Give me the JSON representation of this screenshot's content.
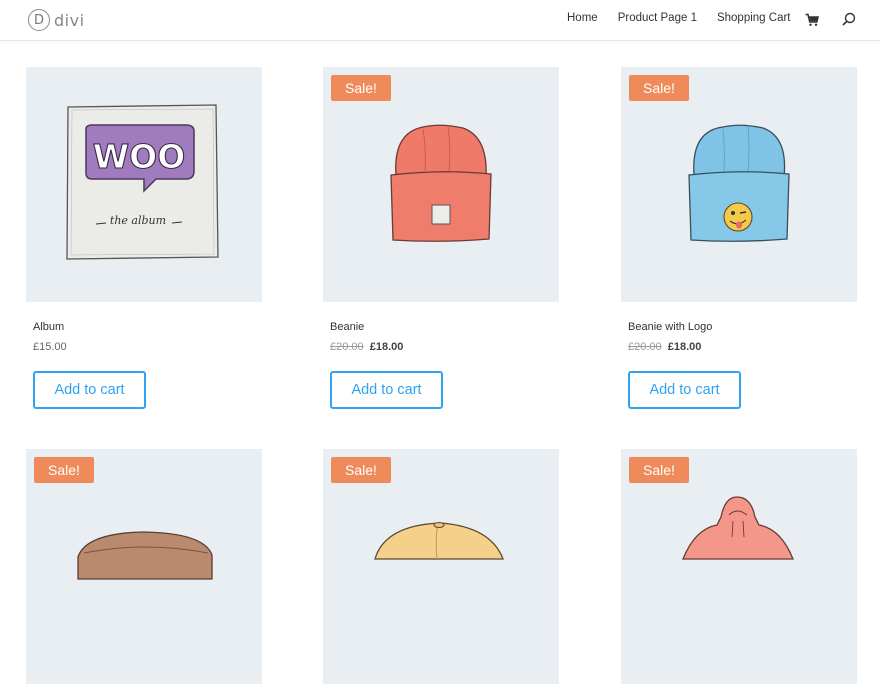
{
  "header": {
    "logo_text": "divi",
    "logo_letter": "D",
    "nav": [
      "Home",
      "Product Page 1",
      "Shopping Cart"
    ]
  },
  "colors": {
    "accent": "#2ea3f2",
    "sale": "#ef8a5b",
    "thumb_bg": "#e9eef3"
  },
  "products": [
    {
      "title": "Album",
      "price": "£15.00",
      "old_price": "",
      "sale": "",
      "button": "Add to cart",
      "image": "woo-album"
    },
    {
      "title": "Beanie",
      "price": "£18.00",
      "old_price": "£20.00",
      "sale": "Sale!",
      "button": "Add to cart",
      "image": "red-beanie"
    },
    {
      "title": "Beanie with Logo",
      "price": "£18.00",
      "old_price": "£20.00",
      "sale": "Sale!",
      "button": "Add to cart",
      "image": "blue-beanie"
    },
    {
      "sale": "Sale!",
      "image": "belt"
    },
    {
      "sale": "Sale!",
      "image": "cap"
    },
    {
      "sale": "Sale!",
      "image": "hoodie"
    }
  ],
  "album_art": {
    "logo": "WOO",
    "caption": "the album"
  }
}
